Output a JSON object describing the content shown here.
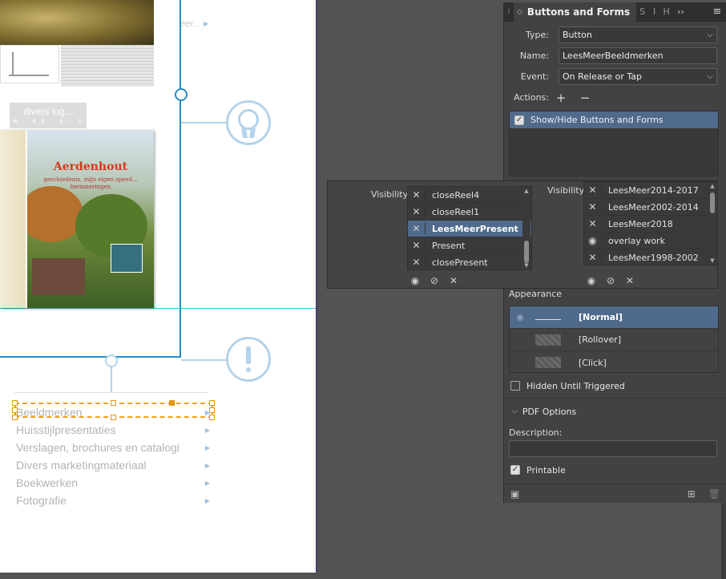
{
  "canvas": {
    "faded_link_text": "eer...",
    "overlay_label": "divers log...",
    "overlay_sublabel": "w... a p... s... n",
    "book_title": "Aerdenhout",
    "book_subtitle": "geschiedenis, mijn eigen speed... herinneringen",
    "menu_items": [
      {
        "label": "Beeldmerken"
      },
      {
        "label": "Huisstijlpresentaties"
      },
      {
        "label": "Verslagen, brochures en catalogi"
      },
      {
        "label": "Divers marketingmateriaal"
      },
      {
        "label": "Boekwerken"
      },
      {
        "label": "Fotografie"
      }
    ],
    "arrow_glyph": "▶"
  },
  "panel": {
    "title": "Buttons and Forms",
    "other_tabs": [
      "S",
      "I",
      "H"
    ],
    "more_glyph": "››",
    "type": {
      "label": "Type:",
      "value": "Button"
    },
    "name": {
      "label": "Name:",
      "value": "LeesMeerBeeldmerken"
    },
    "event": {
      "label": "Event:",
      "value": "On Release or Tap"
    },
    "actions": {
      "label": "Actions:",
      "add": "+",
      "remove": "−"
    },
    "action_items": [
      {
        "label": "Show/Hide Buttons and Forms",
        "checked": true
      }
    ],
    "appearance": {
      "label": "Appearance",
      "states": [
        {
          "label": "[Normal]",
          "selected": true
        },
        {
          "label": "[Rollover]",
          "selected": false
        },
        {
          "label": "[Click]",
          "selected": false
        }
      ]
    },
    "hidden_until_triggered": {
      "label": "Hidden Until Triggered",
      "checked": false
    },
    "pdf_options": {
      "label": "PDF Options"
    },
    "description": {
      "label": "Description:",
      "value": ""
    },
    "printable": {
      "label": "Printable",
      "checked": true
    }
  },
  "popup": {
    "left": {
      "label": "Visibility:",
      "items": [
        {
          "icon": "✕",
          "label": "closeReel4",
          "selected": false
        },
        {
          "icon": "✕",
          "label": "closeReel1",
          "selected": false
        },
        {
          "icon": "✕",
          "label": "LeesMeerPresent",
          "selected": true
        },
        {
          "icon": "✕",
          "label": "Present",
          "selected": false
        },
        {
          "icon": "✕",
          "label": "closePresent",
          "selected": false
        }
      ]
    },
    "right": {
      "label": "Visibility:",
      "items": [
        {
          "icon": "✕",
          "label": "LeesMeer2014-2017"
        },
        {
          "icon": "✕",
          "label": "LeesMeer2002-2014"
        },
        {
          "icon": "✕",
          "label": "LeesMeer2018"
        },
        {
          "icon": "◉",
          "label": "overlay work"
        },
        {
          "icon": "✕",
          "label": "LeesMeer1998-2002"
        }
      ]
    }
  },
  "colors": {
    "accent_selection": "#4f6a8a",
    "frame_blue": "#2a8ac2",
    "selection_orange": "#f1a11a"
  }
}
